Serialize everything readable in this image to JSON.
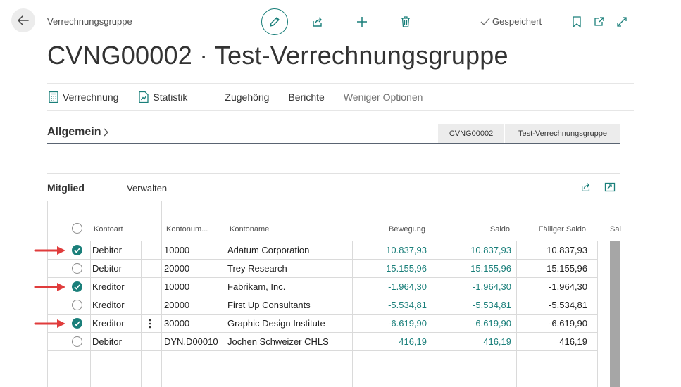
{
  "header": {
    "breadcrumb": "Verrechnungsgruppe",
    "title": "CVNG00002 · Test-Verrechnungsgruppe",
    "saved_status": "Gespeichert"
  },
  "actions": {
    "verrechnung": "Verrechnung",
    "statistik": "Statistik",
    "zugehoerig": "Zugehörig",
    "berichte": "Berichte",
    "weniger_optionen": "Weniger Optionen"
  },
  "general": {
    "title": "Allgemein",
    "summary_no": "CVNG00002",
    "summary_name": "Test-Verrechnungsgruppe"
  },
  "members": {
    "title": "Mitglied",
    "manage": "Verwalten",
    "columns": {
      "kontoart": "Kontoart",
      "kontonummer": "Kontonum...",
      "kontoname": "Kontoname",
      "bewegung": "Bewegung",
      "saldo": "Saldo",
      "faelliger_saldo": "Fälliger Saldo",
      "more": "Sal"
    },
    "rows": [
      {
        "selected": true,
        "kontoart": "Debitor",
        "nummer": "10000",
        "name": "Adatum Corporation",
        "bewegung": "10.837,93",
        "saldo": "10.837,93",
        "faellig": "10.837,93"
      },
      {
        "selected": false,
        "kontoart": "Debitor",
        "nummer": "20000",
        "name": "Trey Research",
        "bewegung": "15.155,96",
        "saldo": "15.155,96",
        "faellig": "15.155,96"
      },
      {
        "selected": true,
        "kontoart": "Kreditor",
        "nummer": "10000",
        "name": "Fabrikam, Inc.",
        "bewegung": "-1.964,30",
        "saldo": "-1.964,30",
        "faellig": "-1.964,30"
      },
      {
        "selected": false,
        "kontoart": "Kreditor",
        "nummer": "20000",
        "name": "First Up Consultants",
        "bewegung": "-5.534,81",
        "saldo": "-5.534,81",
        "faellig": "-5.534,81"
      },
      {
        "selected": true,
        "kontoart": "Kreditor",
        "nummer": "30000",
        "name": "Graphic Design Institute",
        "bewegung": "-6.619,90",
        "saldo": "-6.619,90",
        "faellig": "-6.619,90"
      },
      {
        "selected": false,
        "kontoart": "Debitor",
        "nummer": "DYN.D00010",
        "name": "Jochen Schweizer CHLS",
        "bewegung": "416,19",
        "saldo": "416,19",
        "faellig": "416,19"
      }
    ]
  },
  "colors": {
    "accent": "#1a7f7a",
    "annotation_arrow": "#e03c3c"
  }
}
